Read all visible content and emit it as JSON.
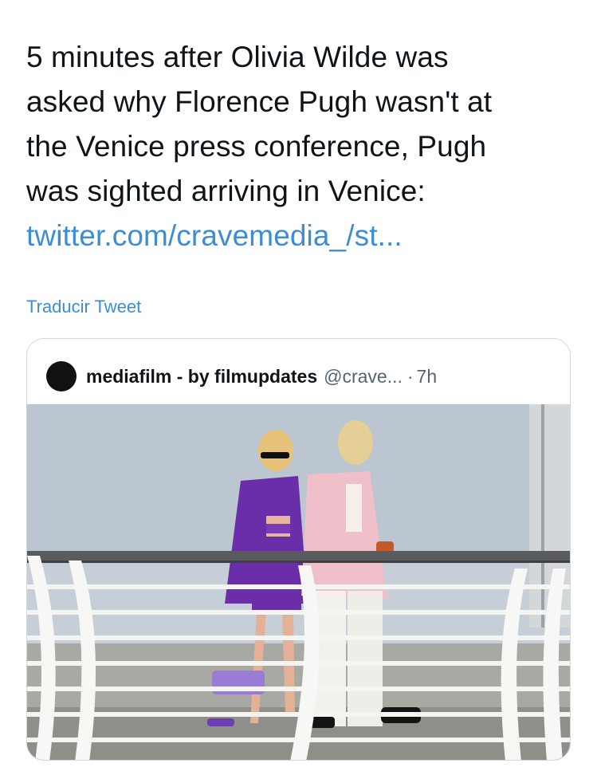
{
  "tweet": {
    "text_lines": [
      "5 minutes after Olivia Wilde was",
      "asked why Florence Pugh wasn't at",
      "the Venice press conference, Pugh",
      "was sighted arriving in Venice:"
    ],
    "link": "twitter.com/cravemedia_/st...",
    "translate_label": "Traducir Tweet"
  },
  "quoted_tweet": {
    "author_name": "mediafilm - by filmupdates",
    "handle": "@crave...",
    "separator": "·",
    "time": "7h"
  },
  "colors": {
    "link": "#3b8ed6",
    "text": "#0f1419",
    "muted": "#536471",
    "border": "#cfd9de"
  }
}
